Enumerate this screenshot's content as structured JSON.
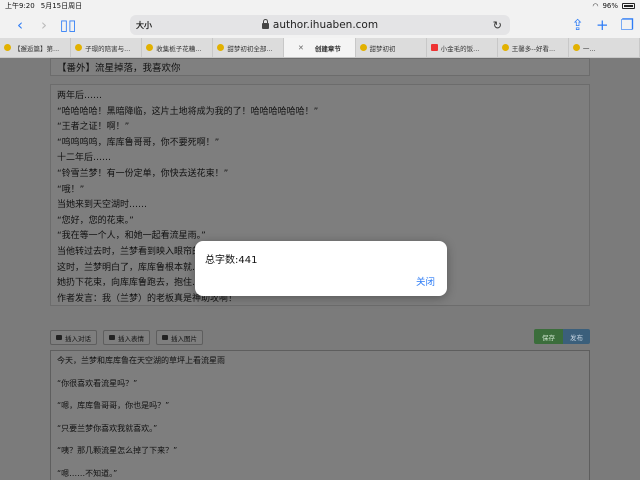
{
  "status": {
    "time": "上午9:20",
    "date": "5月15日周日",
    "battery": "96%"
  },
  "toolbar": {
    "reader_label": "大小",
    "url": "author.ihuaben.com"
  },
  "tabs": [
    {
      "label": "【邂逅篇】第...",
      "active": false
    },
    {
      "label": "子璟的陪害与...",
      "active": false
    },
    {
      "label": "收集栀子花糟...",
      "active": false
    },
    {
      "label": "甜梦初初全部...",
      "active": false
    },
    {
      "label": "创建章节",
      "active": true
    },
    {
      "label": "甜梦初初",
      "active": false
    },
    {
      "label": "小金毛的饭...",
      "active": false
    },
    {
      "label": "王馨多--好看...",
      "active": false
    },
    {
      "label": "一...",
      "active": false
    }
  ],
  "page": {
    "chapter_title": "【番外】流星掉落，我喜欢你",
    "story_lines": [
      "两年后……",
      "“哈哈哈哈！黑暗降临，这片土地将成为我的了！哈哈哈哈哈哈！”",
      "“王者之证！啊！”",
      "“呜呜呜呜，库库鲁哥哥，你不要死啊！”",
      "十二年后……",
      "“铃雪兰梦！有一份定单，你快去送花束！”",
      "“哦！”",
      "当她来到天空湖时……",
      "“您好，您的花束。”",
      "“我在等一个人，和她一起看流星雨。”",
      "当他转过去时，兰梦看到映入眼帘的……",
      "这时，兰梦明白了，库库鲁根本就……",
      "她扔下花束，向库库鲁跑去，抱住……",
      "作者发言：我（兰梦）的老板真是神助攻啊！"
    ],
    "tools": {
      "dialog": "插入对话",
      "emoji": "插入表情",
      "image": "插入图片"
    },
    "save": "保存",
    "publish": "发布",
    "editor_lines": [
      "今天，兰梦和库库鲁在天空湖的草坪上看流星雨",
      "“你很喜欢看流星吗？”",
      "“嗯，库库鲁哥哥，你也是吗？”",
      "“只要兰梦你喜欢我就喜欢。”",
      "“咦？那几颗流星怎么掉了下来？”",
      "“嗯……不知道。”"
    ]
  },
  "dialog": {
    "message": "总字数:441",
    "close": "关闭"
  }
}
